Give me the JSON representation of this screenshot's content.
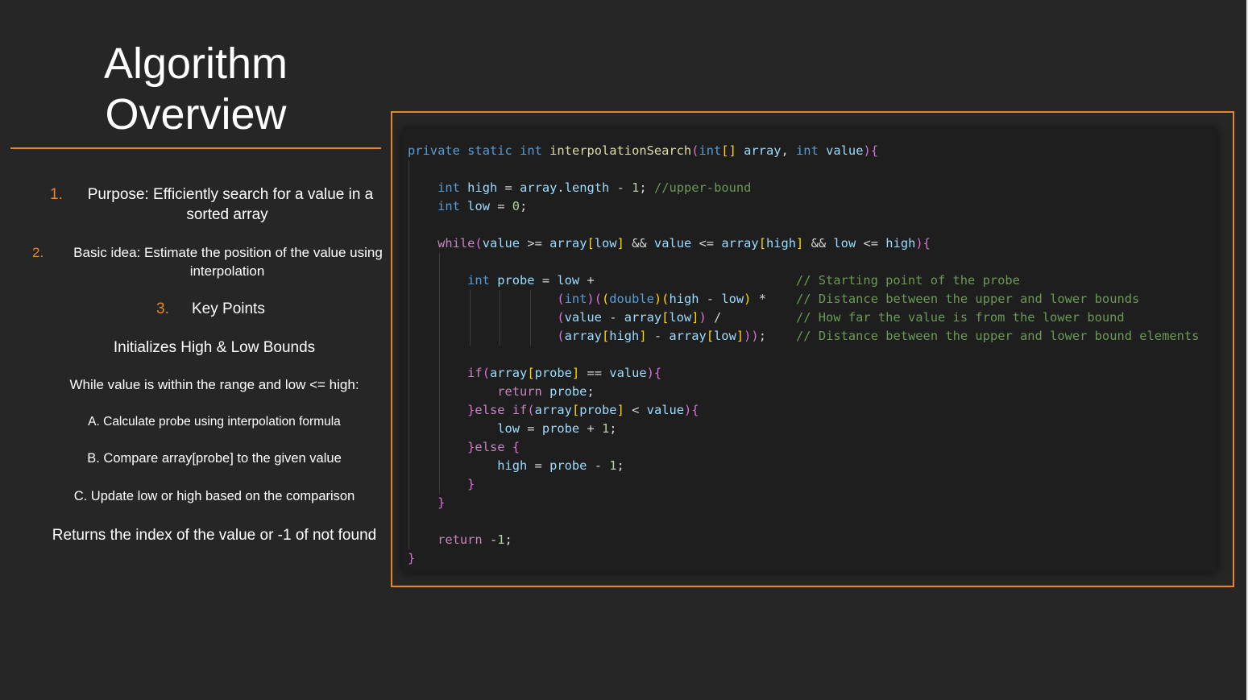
{
  "slide": {
    "title_line1": "Algorithm",
    "title_line2": "Overview",
    "items": [
      {
        "num": "1.",
        "text": "Purpose: Efficiently search for a value in a"
      },
      {
        "text": "sorted array"
      },
      {
        "num": "2.",
        "text": "Basic idea: Estimate the position of the value using"
      },
      {
        "text": "interpolation"
      },
      {
        "num": "3.",
        "text": "Key Points"
      },
      {
        "text": "Initializes High & Low Bounds"
      },
      {
        "text": "While value is within the range and low <= high:"
      },
      {
        "text": "A. Calculate probe using interpolation formula"
      },
      {
        "text": "B. Compare array[probe] to the given value"
      },
      {
        "text": "C. Update low or high based on the comparison"
      },
      {
        "text": "Returns the index of the value or -1 of not found"
      }
    ],
    "colors": {
      "accent": "#e6862a",
      "background": "#262626",
      "code_background": "#1e1e1e"
    }
  },
  "code": {
    "language": "java",
    "lines": [
      "private static int interpolationSearch(int[] array, int value){",
      "",
      "    int high = array.length - 1; //upper-bound",
      "    int low = 0;",
      "",
      "    while(value >= array[low] && value <= array[high] && low <= high){",
      "",
      "        int probe = low +                           // Starting point of the probe",
      "                    (int)((double)(high - low) *    // Distance between the upper and lower bounds",
      "                    (value - array[low]) /          // How far the value is from the lower bound",
      "                    (array[high] - array[low]));    // Distance between the upper and lower bound elements",
      "",
      "        if(array[probe] == value){",
      "            return probe;",
      "        }else if(array[probe] < value){",
      "            low = probe + 1;",
      "        }else {",
      "            high = probe - 1;",
      "        }",
      "    }",
      "",
      "    return -1;",
      "}"
    ]
  }
}
